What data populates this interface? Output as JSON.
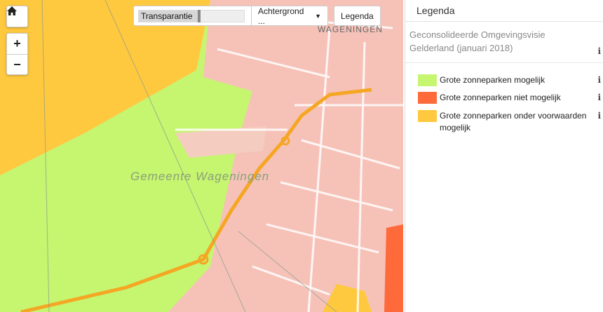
{
  "map": {
    "town_label": "WAGENINGEN",
    "municipality_label": "Gemeente Wageningen",
    "colors": {
      "mogelijk": "#c6f570",
      "niet_mogelijk": "#ff6a3b",
      "voorwaarden": "#ffc93f",
      "urban": "#f6c2b8",
      "road": "#f5a623"
    }
  },
  "controls": {
    "home_icon": "home-icon",
    "zoom_in": "+",
    "zoom_out": "−"
  },
  "toolbar": {
    "transparency_label": "Transparantie",
    "transparency_value": 0.57,
    "background_label": "Achtergrond ...",
    "legend_label": "Legenda"
  },
  "legend": {
    "header": "Legenda",
    "layer_title": "Geconsolideerde Omgevingsvisie Gelderland (januari 2018)",
    "items": [
      {
        "label": "Grote zonneparken mogelijk",
        "color": "#c6f570"
      },
      {
        "label": "Grote zonneparken niet mogelijk",
        "color": "#ff6a3b"
      },
      {
        "label": "Grote zonneparken onder voorwaarden mogelijk",
        "color": "#ffc93f"
      }
    ]
  }
}
